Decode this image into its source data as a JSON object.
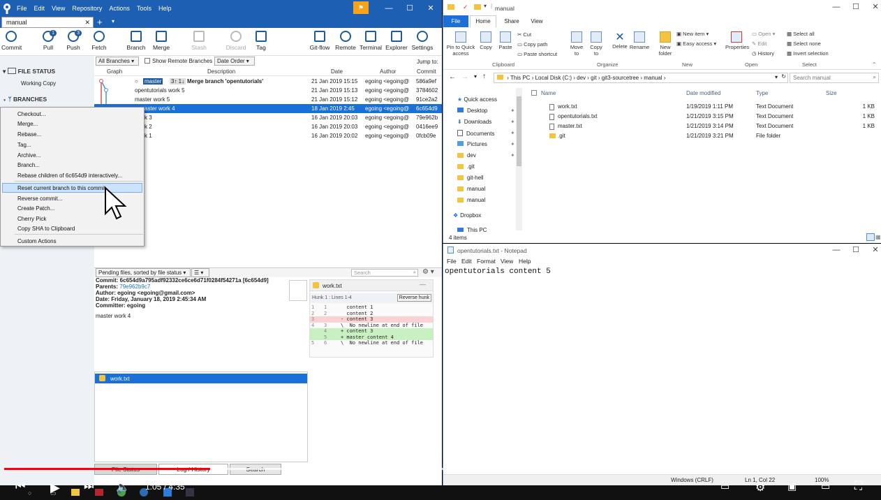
{
  "sourcetree": {
    "menu": [
      "File",
      "Edit",
      "View",
      "Repository",
      "Actions",
      "Tools",
      "Help"
    ],
    "tab": "manual",
    "toolbar": [
      {
        "label": "Commit",
        "badge": ""
      },
      {
        "label": "Pull",
        "badge": "1"
      },
      {
        "label": "Push",
        "badge": "3"
      },
      {
        "label": "Fetch",
        "badge": ""
      },
      {
        "label": "Branch",
        "badge": ""
      },
      {
        "label": "Merge",
        "badge": ""
      },
      {
        "label": "Stash",
        "badge": ""
      },
      {
        "label": "Discard",
        "badge": ""
      },
      {
        "label": "Tag",
        "badge": ""
      },
      {
        "label": "Git-flow",
        "badge": ""
      },
      {
        "label": "Remote",
        "badge": ""
      },
      {
        "label": "Terminal",
        "badge": ""
      },
      {
        "label": "Explorer",
        "badge": ""
      },
      {
        "label": "Settings",
        "badge": ""
      }
    ],
    "sidebar": {
      "file_status": "FILE STATUS",
      "working_copy": "Working Copy",
      "branches": "BRANCHES"
    },
    "filters": {
      "branches": "All Branches",
      "show_remote": "Show Remote Branches",
      "order": "Date Order",
      "jump": "Jump to:"
    },
    "columns": [
      "Graph",
      "Description",
      "Date",
      "Author",
      "Commit"
    ],
    "commits": [
      {
        "desc": "Merge branch 'opentutorials'",
        "tags": [
          "master",
          "3↑ 1↓"
        ],
        "date": "21 Jan 2019 15:15",
        "author": "egoing <egoing@",
        "hash": "586a9ef"
      },
      {
        "desc": "opentutorials work 5",
        "tags": [],
        "date": "21 Jan 2019 15:13",
        "author": "egoing <egoing@",
        "hash": "3784602"
      },
      {
        "desc": "master work 5",
        "tags": [],
        "date": "21 Jan 2019 15:12",
        "author": "egoing <egoing@",
        "hash": "91ce2a2"
      },
      {
        "desc": "aster work 4",
        "tags": [],
        "date": "18 Jan 2019 2:45",
        "author": "egoing <egoing@",
        "hash": "6c654d9"
      },
      {
        "desc": "k 3",
        "tags": [],
        "date": "16 Jan 2019 20:03",
        "author": "egoing <egoing@",
        "hash": "79e962b"
      },
      {
        "desc": "k 2",
        "tags": [],
        "date": "16 Jan 2019 20:03",
        "author": "egoing <egoing@",
        "hash": "0416ee9"
      },
      {
        "desc": "k 1",
        "tags": [],
        "date": "16 Jan 2019 20:02",
        "author": "egoing <egoing@",
        "hash": "0fcb09e"
      }
    ],
    "context_menu": {
      "group1": [
        "Checkout...",
        "Merge...",
        "Rebase...",
        "Tag...",
        "Archive...",
        "Branch...",
        "Rebase children of 6c654d9 interactively..."
      ],
      "highlighted": "Reset current branch to this commit",
      "group2": [
        "Reverse commit...",
        "Create Patch...",
        "Cherry Pick",
        "Copy SHA to Clipboard"
      ],
      "group3": [
        "Custom Actions"
      ]
    },
    "pending": "Pending files, sorted by file status",
    "search_placeholder": "Search",
    "commit_info": {
      "commit": "Commit: 6c654d9a795adf92332ce6ce6d71f0284f54271a [6c654d9]",
      "parents_label": "Parents:",
      "parents_value": "79e962b9c7",
      "author": "Author: egoing <egoing@gmail.com>",
      "date": "Date: Friday, January 18, 2019 2:45:34 AM",
      "committer": "Committer: egoing",
      "message": "master work 4"
    },
    "diff": {
      "file": "work.txt",
      "hunk": "Hunk 1 : Lines 1-4",
      "reverse": "Reverse hunk",
      "lines": [
        {
          "a": "1",
          "b": "1",
          "text": "  content 1",
          "kind": "ctx"
        },
        {
          "a": "2",
          "b": "2",
          "text": "  content 2",
          "kind": "ctx"
        },
        {
          "a": "3",
          "b": "",
          "text": "- content 3",
          "kind": "del"
        },
        {
          "a": "4",
          "b": "3",
          "text": "\\  No newline at end of file",
          "kind": "ctx"
        },
        {
          "a": "",
          "b": "4",
          "text": "+ content 3",
          "kind": "add"
        },
        {
          "a": "",
          "b": "5",
          "text": "+ master content 4",
          "kind": "add"
        },
        {
          "a": "5",
          "b": "6",
          "text": "\\  No newline at end of file",
          "kind": "ctx"
        }
      ]
    },
    "changed_file": "work.txt",
    "bottom_tabs": [
      "File Status",
      "Log / History",
      "Search"
    ]
  },
  "explorer": {
    "title": "manual",
    "tabs": [
      "File",
      "Home",
      "Share",
      "View"
    ],
    "ribbon": {
      "clipboard": {
        "pin": "Pin to Quick access",
        "copy": "Copy",
        "paste": "Paste",
        "cut": "Cut",
        "copy_path": "Copy path",
        "paste_shortcut": "Paste shortcut",
        "group": "Clipboard"
      },
      "organize": {
        "move": "Move to",
        "copy": "Copy to",
        "delete": "Delete",
        "rename": "Rename",
        "group": "Organize"
      },
      "new": {
        "folder": "New folder",
        "item": "New item",
        "easy": "Easy access",
        "group": "New"
      },
      "open": {
        "properties": "Properties",
        "open": "Open",
        "edit": "Edit",
        "history": "History",
        "group": "Open"
      },
      "select": {
        "all": "Select all",
        "none": "Select none",
        "invert": "Invert selection",
        "group": "Select"
      }
    },
    "address": [
      "This PC",
      "Local Disk (C:)",
      "dev",
      "git",
      "git3-sourcetree",
      "manual"
    ],
    "search_placeholder": "Search manual",
    "nav": [
      {
        "label": "Quick access",
        "kind": "star"
      },
      {
        "label": "Desktop",
        "kind": "blue"
      },
      {
        "label": "Downloads",
        "kind": "blue"
      },
      {
        "label": "Documents",
        "kind": "blue"
      },
      {
        "label": "Pictures",
        "kind": "blue"
      },
      {
        "label": "dev",
        "kind": "folder"
      },
      {
        "label": ".git",
        "kind": "folder"
      },
      {
        "label": "git-hell",
        "kind": "folder"
      },
      {
        "label": "manual",
        "kind": "folder"
      },
      {
        "label": "manual",
        "kind": "folder"
      },
      {
        "label": "Dropbox",
        "kind": "blue"
      },
      {
        "label": "This PC",
        "kind": "blue"
      }
    ],
    "columns": [
      "Name",
      "Date modified",
      "Type",
      "Size"
    ],
    "files": [
      {
        "name": "work.txt",
        "date": "1/19/2019 1:11 PM",
        "type": "Text Document",
        "size": "1 KB"
      },
      {
        "name": "opentutorials.txt",
        "date": "1/21/2019 3:15 PM",
        "type": "Text Document",
        "size": "1 KB"
      },
      {
        "name": "master.txt",
        "date": "1/21/2019 3:14 PM",
        "type": "Text Document",
        "size": "1 KB"
      },
      {
        "name": ".git",
        "date": "1/21/2019 3:21 PM",
        "type": "File folder",
        "size": ""
      }
    ],
    "status": "4 items"
  },
  "notepad": {
    "title": "opentutorials.txt - Notepad",
    "menu": [
      "File",
      "Edit",
      "Format",
      "View",
      "Help"
    ],
    "content": "opentutorials content 5",
    "status_encoding": "Windows (CRLF)",
    "status_pos": "Ln 1, Col 22",
    "status_zoom": "100%"
  },
  "video": {
    "time": "1:05 / 4:35",
    "progress_fraction": 0.236,
    "buffer_fraction": 0.53
  },
  "colors": {
    "sourcetree_blue": "#1c5fb3",
    "selection": "#1a6fd8",
    "progress_red": "#ff0000"
  }
}
